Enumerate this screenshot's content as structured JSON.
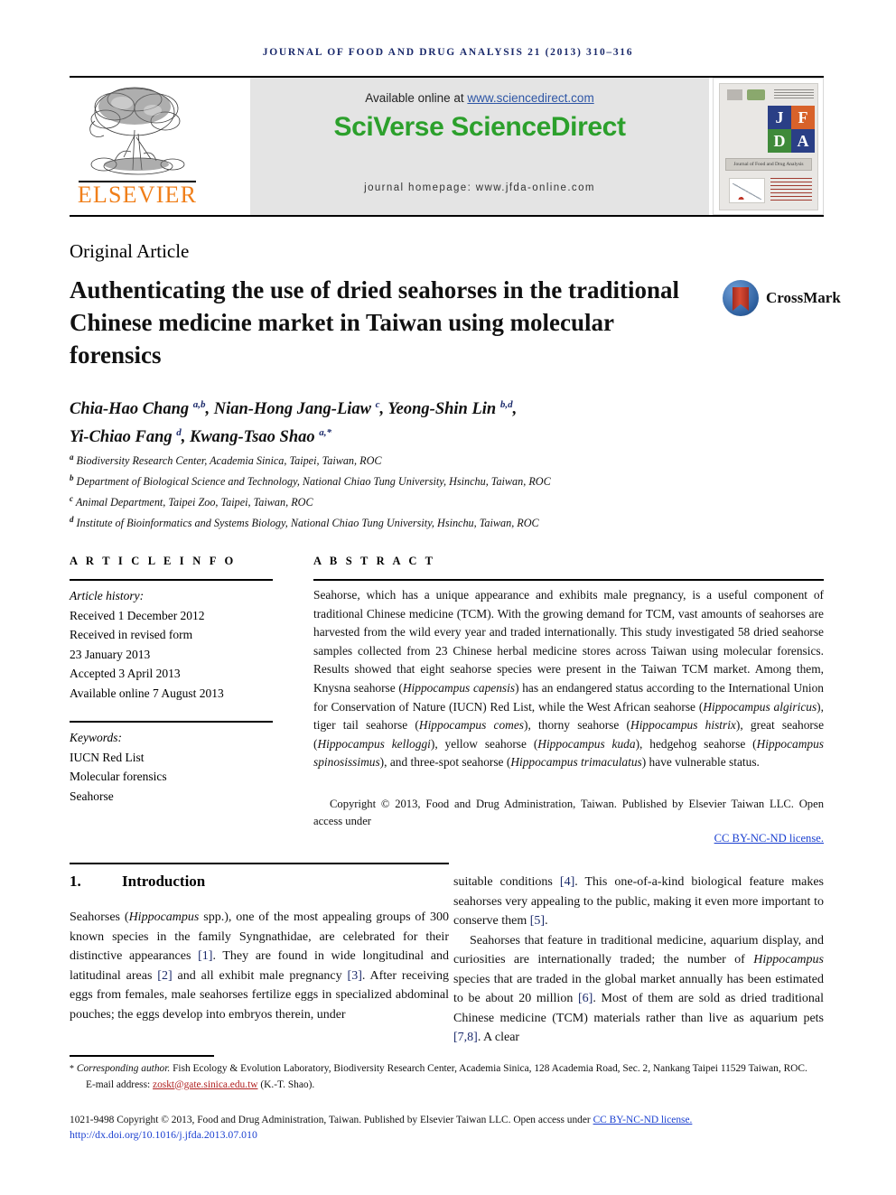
{
  "running_head": "JOURNAL OF FOOD AND DRUG ANALYSIS 21 (2013) 310–316",
  "masthead": {
    "publisher_name": "ELSEVIER",
    "available_prefix": "Available online at ",
    "available_url": "www.sciencedirect.com",
    "platform_logo": "SciVerse ScienceDirect",
    "homepage": "journal homepage: www.jfda-online.com",
    "cover": {
      "letters": [
        "J",
        "F",
        "D",
        "A"
      ],
      "caption": "Journal of Food and Drug Analysis"
    },
    "colors": {
      "sciencedirect_green": "#2ca02c",
      "elsevier_orange": "#f07f1a",
      "banner_gray": "#e4e4e4",
      "link_blue": "#2d55a5"
    }
  },
  "article": {
    "type": "Original Article",
    "title": "Authenticating the use of dried seahorses in the traditional Chinese medicine market in Taiwan using molecular forensics",
    "crossmark_label": "CrossMark",
    "authors_line1": "Chia-Hao Chang <sup>a,b</sup>, Nian-Hong Jang-Liaw <sup>c</sup>, Yeong-Shin Lin <sup>b,d</sup>,",
    "authors_line2": "Yi-Chiao Fang <sup>d</sup>, Kwang-Tsao Shao <sup>a,*</sup>",
    "affiliations": [
      "<sup>a</sup> Biodiversity Research Center, Academia Sinica, Taipei, Taiwan, ROC",
      "<sup>b</sup> Department of Biological Science and Technology, National Chiao Tung University, Hsinchu, Taiwan, ROC",
      "<sup>c</sup> Animal Department, Taipei Zoo, Taipei, Taiwan, ROC",
      "<sup>d</sup> Institute of Bioinformatics and Systems Biology, National Chiao Tung University, Hsinchu, Taiwan, ROC"
    ]
  },
  "info": {
    "heading": "A R T I C L E   I N F O",
    "history_label": "Article history:",
    "history": [
      "Received 1 December 2012",
      "Received in revised form",
      "23 January 2013",
      "Accepted 3 April 2013",
      "Available online 7 August 2013"
    ],
    "keywords_label": "Keywords:",
    "keywords": [
      "IUCN Red List",
      "Molecular forensics",
      "Seahorse"
    ]
  },
  "abstract": {
    "heading": "A B S T R A C T",
    "body": "Seahorse, which has a unique appearance and exhibits male pregnancy, is a useful component of traditional Chinese medicine (TCM). With the growing demand for TCM, vast amounts of seahorses are harvested from the wild every year and traded internationally. This study investigated 58 dried seahorse samples collected from 23 Chinese herbal medicine stores across Taiwan using molecular forensics. Results showed that eight seahorse species were present in the Taiwan TCM market. Among them, Knysna seahorse (<i>Hippocampus capensis</i>) has an endangered status according to the International Union for Conservation of Nature (IUCN) Red List, while the West African seahorse (<i>Hippocampus algiricus</i>), tiger tail seahorse (<i>Hippocampus comes</i>), thorny seahorse (<i>Hippocampus histrix</i>), great seahorse (<i>Hippocampus kelloggi</i>), yellow seahorse (<i>Hippocampus kuda</i>), hedgehog seahorse (<i>Hippocampus spinosissimus</i>), and three-spot seahorse (<i>Hippocampus trimaculatus</i>) have vulnerable status.",
    "copyright_text": "Copyright © 2013, Food and Drug Administration, Taiwan. Published by Elsevier Taiwan LLC. Open access under ",
    "license_link": "CC BY-NC-ND license."
  },
  "body": {
    "section_number": "1.",
    "section_title": "Introduction",
    "left_paragraphs": [
      "Seahorses (<i>Hippocampus</i> spp.), one of the most appealing groups of 300 known species in the family Syngnathidae, are celebrated for their distinctive appearances <span class=\"ref\">[1]</span>. They are found in wide longitudinal and latitudinal areas <span class=\"ref\">[2]</span> and all exhibit male pregnancy <span class=\"ref\">[3]</span>. After receiving eggs from females, male seahorses fertilize eggs in specialized abdominal pouches; the eggs develop into embryos therein, under"
    ],
    "right_paragraphs": [
      "suitable conditions <span class=\"ref\">[4]</span>. This one-of-a-kind biological feature makes seahorses very appealing to the public, making it even more important to conserve them <span class=\"ref\">[5]</span>.",
      "Seahorses that feature in traditional medicine, aquarium display, and curiosities are internationally traded; the number of <i>Hippocampus</i> species that are traded in the global market annually has been estimated to be about 20 million <span class=\"ref\">[6]</span>. Most of them are sold as dried traditional Chinese medicine (TCM) materials rather than live as aquarium pets <span class=\"ref\">[7,8]</span>. A clear"
    ]
  },
  "footer": {
    "corresponding": "<span class=\"star\">*</span> <span class=\"ital\">Corresponding author.</span> Fish Ecology & Evolution Laboratory, Biodiversity Research Center, Academia Sinica, 128 Academia Road, Sec. 2, Nankang Taipei 11529 Taiwan, ROC.",
    "email_prefix": "E-mail address: ",
    "email": "zoskt@gate.sinica.edu.tw",
    "email_suffix": " (K.-T. Shao).",
    "issn_copyright": "1021-9498 Copyright © 2013, Food and Drug Administration, Taiwan. Published by Elsevier Taiwan LLC. Open access under ",
    "issn_license": "CC BY-NC-ND license.",
    "doi": "http://dx.doi.org/10.1016/j.jfda.2013.07.010"
  }
}
